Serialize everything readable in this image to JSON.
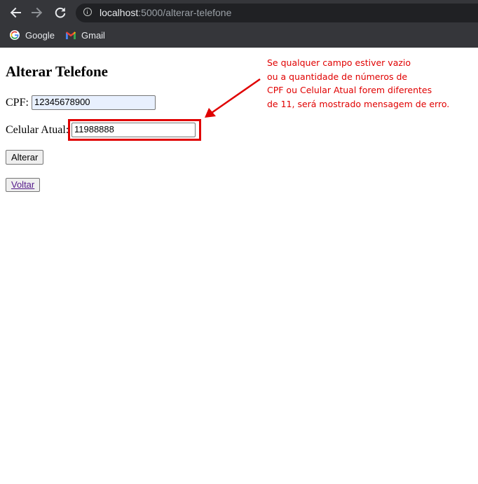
{
  "browser": {
    "url_host": "localhost",
    "url_path": ":5000/alterar-telefone",
    "bookmarks": [
      {
        "label": "Google",
        "icon": "google-icon"
      },
      {
        "label": "Gmail",
        "icon": "gmail-icon"
      }
    ],
    "icons": [
      "back-arrow-icon",
      "forward-arrow-icon",
      "reload-icon",
      "info-icon"
    ]
  },
  "page": {
    "title": "Alterar Telefone",
    "cpf_label": "CPF:",
    "cpf_value": "12345678900",
    "celular_label": "Celular Atual:",
    "celular_value": "11988888",
    "submit_label": "Alterar",
    "back_link": "Voltar"
  },
  "annotation": {
    "lines": [
      "Se qualquer campo estiver vazio",
      "ou a quantidade de números de",
      "CPF ou Celular Atual forem diferentes",
      "de 11, será mostrado mensagem de erro."
    ],
    "color": "#e00000"
  },
  "colors": {
    "chrome_bg": "#35363a",
    "omnibox_bg": "#202124",
    "autofill_bg": "#e8f0fe",
    "link": "#551a8b"
  }
}
